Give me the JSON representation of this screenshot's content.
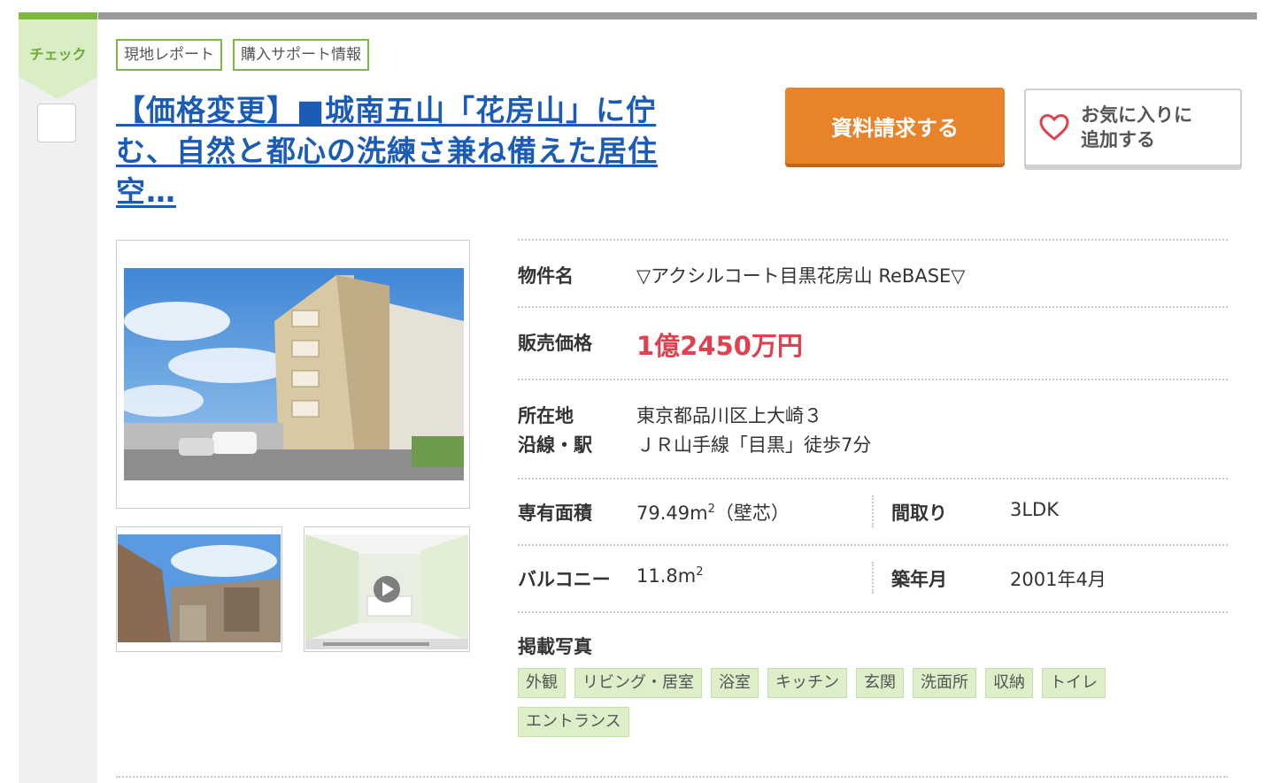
{
  "check": {
    "label": "チェック"
  },
  "tags": [
    "現地レポート",
    "購入サポート情報"
  ],
  "title": "【価格変更】■城南五山「花房山」に佇む、自然と都心の洗練さ兼ね備えた居住空…",
  "buttons": {
    "request": "資料請求する",
    "favorite_line1": "お気に入りに",
    "favorite_line2": "追加する"
  },
  "details": {
    "name_label": "物件名",
    "name_value": "▽アクシルコート目黒花房山 ReBASE▽",
    "price_label": "販売価格",
    "price_value": "1億2450万円",
    "address_label": "所在地",
    "address_value": "東京都品川区上大崎３",
    "station_label": "沿線・駅",
    "station_value": "ＪＲ山手線「目黒」徒歩7分",
    "area_label": "専有面積",
    "area_value": "79.49m",
    "area_sup": "2",
    "area_note": "（壁芯）",
    "layout_label": "間取り",
    "layout_value": "3LDK",
    "balcony_label": "バルコニー",
    "balcony_value": "11.8m",
    "balcony_sup": "2",
    "built_label": "築年月",
    "built_value": "2001年4月",
    "photos_label": "掲載写真"
  },
  "photo_tags": [
    "外観",
    "リビング・居室",
    "浴室",
    "キッチン",
    "玄関",
    "洗面所",
    "収納",
    "トイレ",
    "エントランス"
  ],
  "colors": {
    "green": "#7fb83e",
    "orange": "#e8832a",
    "link": "#1a5bb8",
    "price": "#e0404f"
  }
}
